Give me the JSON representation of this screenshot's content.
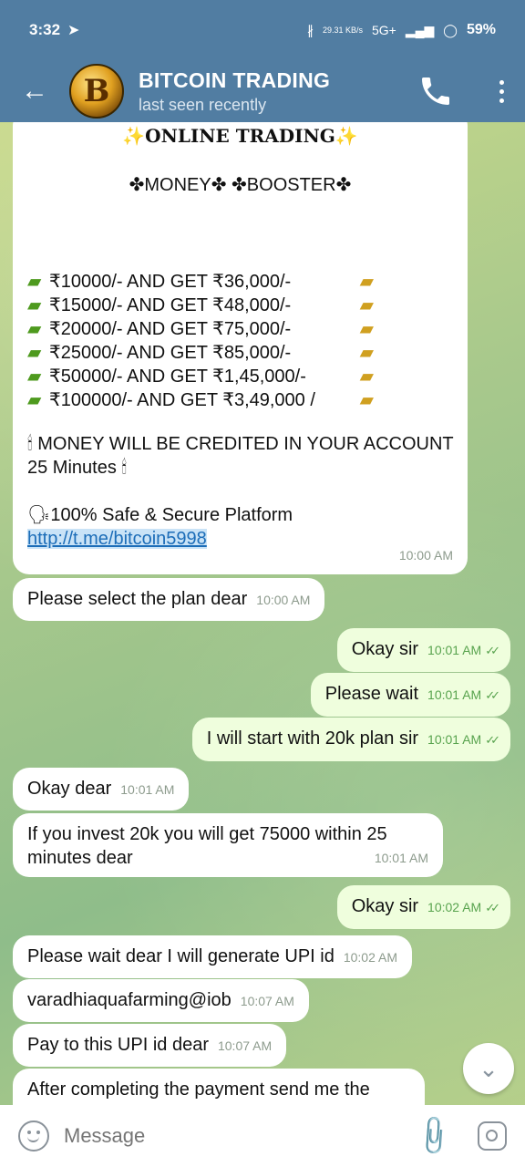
{
  "status_bar": {
    "time": "3:32",
    "network_speed": "29.31 KB/s",
    "network_type": "5G+",
    "battery": "59%"
  },
  "header": {
    "title": "BITCOIN TRADING",
    "subtitle": "last seen recently",
    "avatar_letter": "B"
  },
  "promo": {
    "title": "✨ONLINE TRADING✨",
    "booster": "✤MONEY✤ ✤BOOSTER✤",
    "plans": [
      {
        "text": "₹10000/- AND GET ₹36,000/-"
      },
      {
        "text": "₹15000/- AND GET ₹48,000/-"
      },
      {
        "text": "₹20000/- AND GET ₹75,000/-"
      },
      {
        "text": "₹25000/- AND GET ₹85,000/-"
      },
      {
        "text": "₹50000/- AND GET ₹1,45,000/-"
      },
      {
        "text": "₹100000/- AND GET ₹3,49,000 /"
      }
    ],
    "credit_note": "MONEY WILL BE CREDITED IN YOUR ACCOUNT 25 Minutes",
    "safe_note": "100% Safe & Secure Platform",
    "link": "http://t.me/bitcoin5998",
    "time": "10:00 AM"
  },
  "messages": [
    {
      "text": "Please select the plan dear",
      "time": "10:00 AM",
      "dir": "in"
    },
    {
      "text": "Okay sir",
      "time": "10:01 AM",
      "dir": "out"
    },
    {
      "text": "Please wait",
      "time": "10:01 AM",
      "dir": "out"
    },
    {
      "text": "I will start with 20k plan sir",
      "time": "10:01 AM",
      "dir": "out"
    },
    {
      "text": "Okay dear",
      "time": "10:01 AM",
      "dir": "in"
    },
    {
      "text": "If you invest 20k you will get 75000 within 25 minutes dear",
      "time": "10:01 AM",
      "dir": "in"
    },
    {
      "text": "Okay sir",
      "time": "10:02 AM",
      "dir": "out"
    },
    {
      "text": "Please wait dear I will generate UPI id",
      "time": "10:02 AM",
      "dir": "in"
    },
    {
      "text": "varadhiaquafarming@iob",
      "time": "10:07 AM",
      "dir": "in"
    },
    {
      "text": "Pay to this UPI id dear",
      "time": "10:07 AM",
      "dir": "in"
    },
    {
      "text": "After completing the payment send me the",
      "time": "",
      "dir": "in"
    }
  ],
  "input": {
    "placeholder": "Message"
  }
}
